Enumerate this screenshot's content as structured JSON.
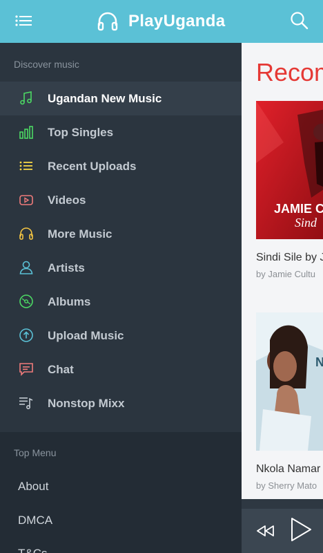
{
  "header": {
    "app_title": "PlayUganda"
  },
  "drawer": {
    "section_discover": "Discover music",
    "items": [
      {
        "label": "Ugandan New Music",
        "icon": "music-note-icon",
        "color": "#4cd964",
        "active": true
      },
      {
        "label": "Top Singles",
        "icon": "bar-chart-icon",
        "color": "#4cd964"
      },
      {
        "label": "Recent Uploads",
        "icon": "list-icon",
        "color": "#f5d547"
      },
      {
        "label": "Videos",
        "icon": "youtube-icon",
        "color": "#f07b7b"
      },
      {
        "label": "More Music",
        "icon": "headphones-icon",
        "color": "#f5c542"
      },
      {
        "label": "Artists",
        "icon": "user-icon",
        "color": "#5bc1d6"
      },
      {
        "label": "Albums",
        "icon": "disc-icon",
        "color": "#4cd964"
      },
      {
        "label": "Upload Music",
        "icon": "upload-icon",
        "color": "#5bc1d6"
      },
      {
        "label": "Chat",
        "icon": "chat-icon",
        "color": "#f07b7b"
      },
      {
        "label": "Nonstop Mixx",
        "icon": "playlist-icon",
        "color": "#c3cad1"
      }
    ],
    "section_top_menu": "Top Menu",
    "top_menu": [
      "About",
      "DMCA",
      "T&Cs"
    ]
  },
  "content": {
    "heading": "Recom",
    "cards": [
      {
        "title": "Sindi Sile by J",
        "subtitle": "by Jamie Cultu",
        "art_text_1": "JAMIE C",
        "art_text_2": "Sind"
      },
      {
        "title": "Nkola Namar",
        "subtitle": "by Sherry Mato",
        "art_text_1": "N"
      }
    ]
  }
}
